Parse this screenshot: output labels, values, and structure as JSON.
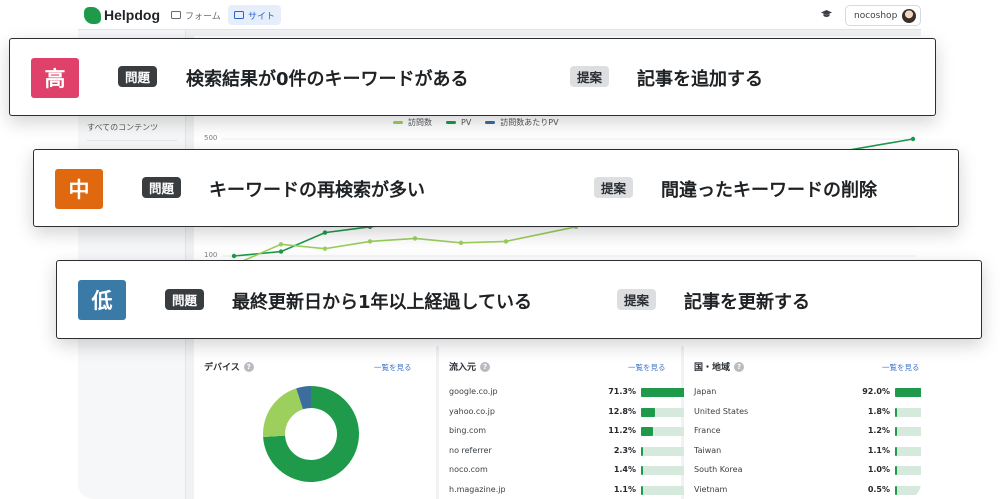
{
  "app": {
    "logo_text": "Helpdog",
    "tabs": [
      {
        "label": "フォーム",
        "icon": "table-icon"
      },
      {
        "label": "サイト",
        "icon": "window-icon"
      }
    ],
    "account": "nocoshop"
  },
  "sidebar": {
    "items": [
      {
        "label": "すべてのコンテンツ"
      }
    ]
  },
  "chart": {
    "legend": [
      "訪問数",
      "PV",
      "訪問数あたりPV"
    ],
    "yticks": [
      "500",
      "100"
    ],
    "colors": {
      "visits": "#9ccf5c",
      "pv": "#1e9a4a",
      "pv_per_visit": "#3b6e9c"
    }
  },
  "chart_data": {
    "type": "line",
    "yticks_visible": [
      "500",
      "100"
    ],
    "series": [
      {
        "name": "PV",
        "values": [
          100,
          115,
          180,
          200,
          215,
          235,
          260,
          300,
          500
        ]
      },
      {
        "name": "訪問数",
        "values": [
          70,
          140,
          125,
          150,
          160,
          145,
          150,
          200
        ]
      }
    ]
  },
  "devices": {
    "title": "デバイス",
    "link": "一覧を見る",
    "slices": [
      {
        "value": 74,
        "color": "#1e9a4a"
      },
      {
        "value": 21,
        "color": "#9ccf5c"
      },
      {
        "value": 5,
        "color": "#3b6e9c"
      }
    ]
  },
  "referrers": {
    "title": "流入元",
    "link": "一覧を見る",
    "rows": [
      {
        "label": "google.co.jp",
        "pct": "71.3%",
        "value": 71.3
      },
      {
        "label": "yahoo.co.jp",
        "pct": "12.8%",
        "value": 12.8
      },
      {
        "label": "bing.com",
        "pct": "11.2%",
        "value": 11.2
      },
      {
        "label": "no referrer",
        "pct": "2.3%",
        "value": 2.3
      },
      {
        "label": "noco.com",
        "pct": "1.4%",
        "value": 1.4
      },
      {
        "label": "h.magazine.jp",
        "pct": "1.1%",
        "value": 1.1
      }
    ]
  },
  "countries": {
    "title": "国・地域",
    "link": "一覧を見る",
    "rows": [
      {
        "label": "Japan",
        "pct": "92.0%",
        "value": 92.0
      },
      {
        "label": "United States",
        "pct": "1.8%",
        "value": 1.8
      },
      {
        "label": "France",
        "pct": "1.2%",
        "value": 1.2
      },
      {
        "label": "Taiwan",
        "pct": "1.1%",
        "value": 1.1
      },
      {
        "label": "South Korea",
        "pct": "1.0%",
        "value": 1.0
      },
      {
        "label": "Vietnam",
        "pct": "0.5%",
        "value": 0.5
      }
    ]
  },
  "cards": [
    {
      "priority": "高",
      "color": "#e0416a",
      "problem_tag": "問題",
      "problem": "検索結果が0件のキーワードがある",
      "proposal_tag": "提案",
      "proposal": "記事を追加する"
    },
    {
      "priority": "中",
      "color": "#e0680e",
      "problem_tag": "問題",
      "problem": "キーワードの再検索が多い",
      "proposal_tag": "提案",
      "proposal": "間違ったキーワードの削除"
    },
    {
      "priority": "低",
      "color": "#3a7aa6",
      "problem_tag": "問題",
      "problem": "最終更新日から1年以上経過している",
      "proposal_tag": "提案",
      "proposal": "記事を更新する"
    }
  ]
}
